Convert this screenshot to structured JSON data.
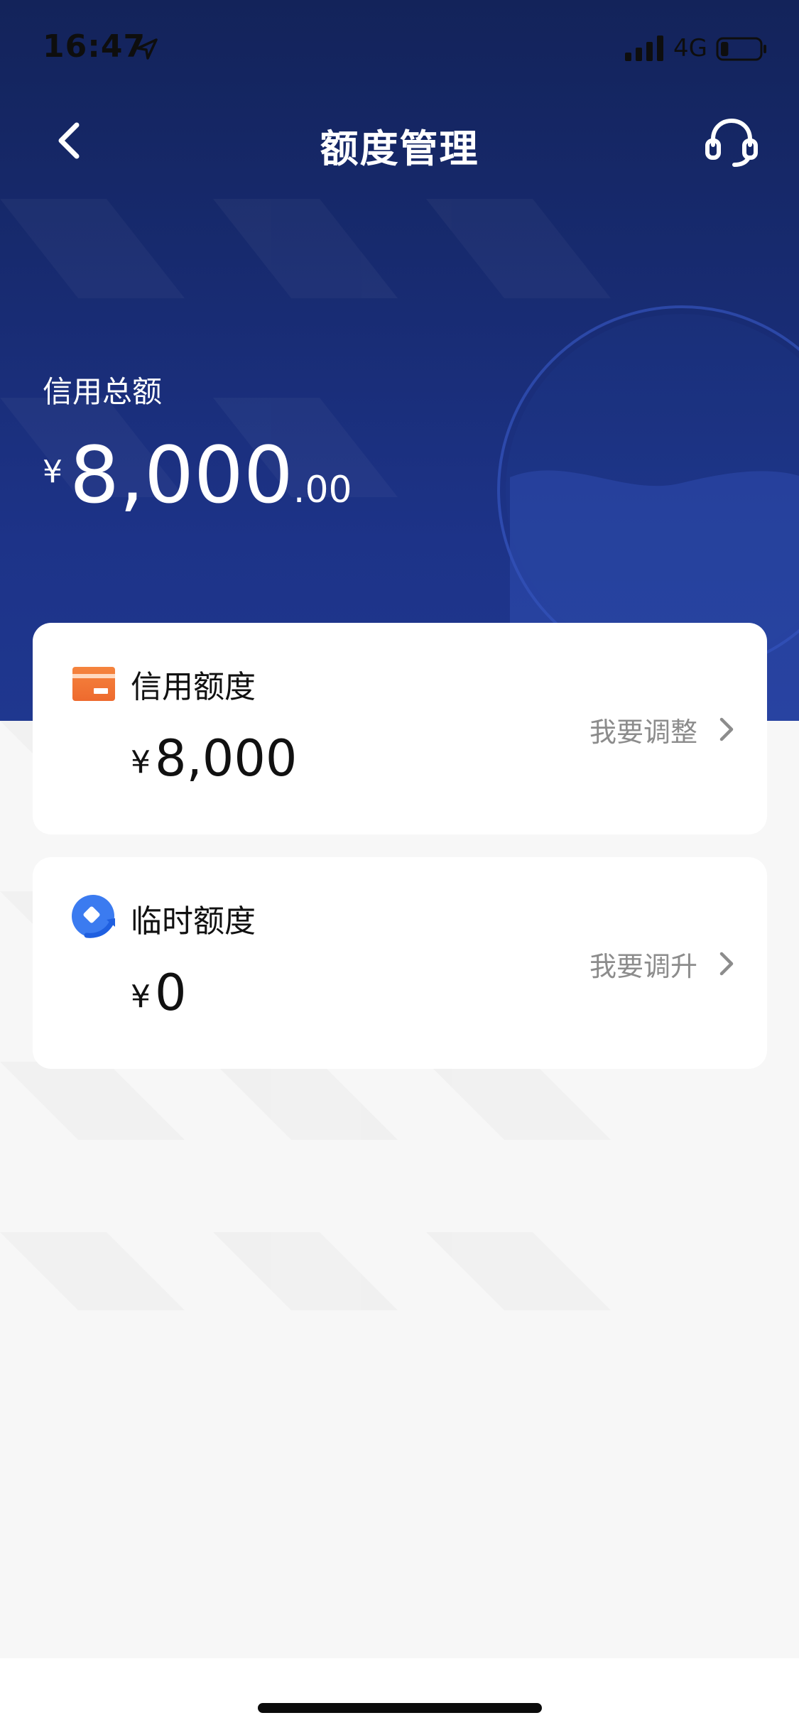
{
  "status_bar": {
    "time": "16:47",
    "network": "4G",
    "battery_level": 0.2
  },
  "nav": {
    "title": "额度管理",
    "back_icon": "chevron-left-icon",
    "service_icon": "headset-icon"
  },
  "summary": {
    "label": "信用总额",
    "currency": "¥",
    "amount_int": "8,000",
    "amount_dec": ".00"
  },
  "cards": [
    {
      "title": "信用额度",
      "currency": "¥",
      "amount": "8,000",
      "action": "我要调整",
      "icon": "credit-card-icon"
    },
    {
      "title": "临时额度",
      "currency": "¥",
      "amount": "0",
      "action": "我要调升",
      "icon": "temporary-quota-icon"
    }
  ],
  "colors": {
    "hero_top": "#13235a",
    "hero_bottom": "#1f378f",
    "accent_orange": "#f07a3a",
    "accent_blue": "#3b7bf0",
    "page_bg": "#f7f7f7"
  }
}
